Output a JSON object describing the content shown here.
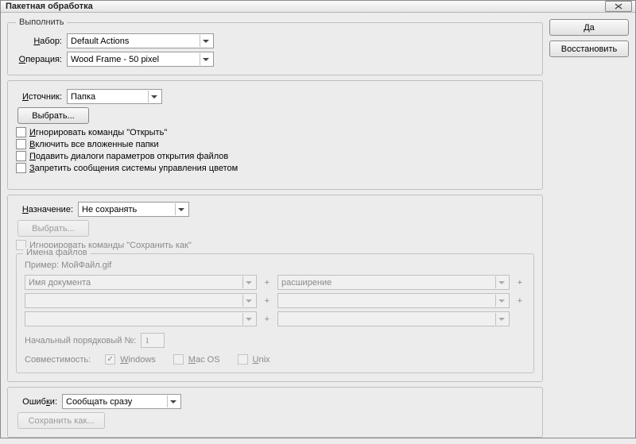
{
  "window": {
    "title": "Пакетная обработка"
  },
  "buttons": {
    "ok": "Да",
    "restore": "Восстановить",
    "choose": "Выбрать...",
    "choose2": "Выбрать...",
    "save_as": "Сохранить как..."
  },
  "play": {
    "legend": "Выполнить",
    "set_label_pre": "Н",
    "set_label_post": "абор:",
    "set_value": "Default Actions",
    "op_label_pre": "О",
    "op_label_post": "перация:",
    "op_value": "Wood Frame - 50 pixel"
  },
  "source": {
    "label_pre": "И",
    "label_post": "сточник:",
    "value": "Папка",
    "opt_open_pre": "И",
    "opt_open_post": "гнорировать команды \"Открыть\"",
    "opt_sub_pre": "В",
    "opt_sub_post": "ключить все вложенные папки",
    "opt_dialog_pre": "П",
    "opt_dialog_post": "одавить диалоги параметров открытия файлов",
    "opt_color_pre": "З",
    "opt_color_post": "апретить сообщения системы управления цветом"
  },
  "dest": {
    "label_pre": "Н",
    "label_post": "азначение:",
    "value": "Не сохранять",
    "opt_saveas_pre": "И",
    "opt_saveas_post": "гнорировать команды \"Сохранить как\"",
    "naming_legend": "Имена файлов",
    "example_text": "Пример: МойФайл.gif",
    "combo_doc": "Имя документа",
    "combo_ext": "расширение",
    "serial_label_pre": "Начальный порядковый №",
    "serial_label_post": ":",
    "serial_value": "1",
    "compat_label": "Совместимость:",
    "compat_win_pre": "W",
    "compat_win_post": "indows",
    "compat_mac_pre": "M",
    "compat_mac_post": "ac OS",
    "compat_unix_pre": "U",
    "compat_unix_post": "nix"
  },
  "errors": {
    "label_pre": "Ошиб",
    "label_u": "к",
    "label_post": "и:",
    "value": "Сообщать сразу"
  }
}
